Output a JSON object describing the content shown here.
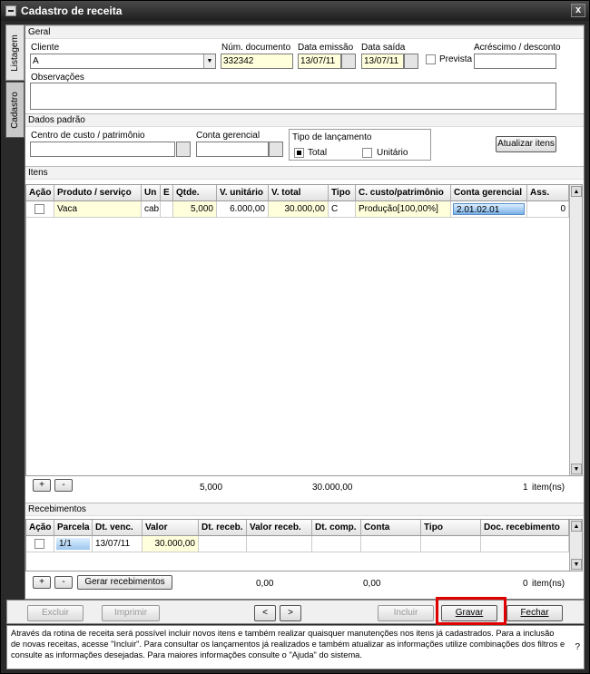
{
  "window": {
    "title": "Cadastro de receita",
    "close_glyph": "x"
  },
  "tabs": [
    {
      "label": "Listagem"
    },
    {
      "label": "Cadastro"
    }
  ],
  "geral": {
    "section_title": "Geral",
    "cliente_label": "Cliente",
    "cliente_value": "A",
    "num_doc_label": "Núm. documento",
    "num_doc_value": "332342",
    "data_emissao_label": "Data emissão",
    "data_emissao_value": "13/07/11",
    "data_saida_label": "Data saída",
    "data_saida_value": "13/07/11",
    "prevista_label": "Prevista",
    "acrescimo_label": "Acréscimo / desconto",
    "acrescimo_value": "",
    "observacoes_label": "Observações",
    "observacoes_value": ""
  },
  "dados_padrao": {
    "section_title": "Dados padrão",
    "centro_label": "Centro de custo / patrimônio",
    "centro_value": "",
    "conta_label": "Conta gerencial",
    "conta_value": "",
    "tipo_label": "Tipo de lançamento",
    "total_label": "Total",
    "unitario_label": "Unitário",
    "atualizar_label": "Atualizar itens"
  },
  "itens": {
    "section_title": "Itens",
    "columns": [
      "Ação",
      "Produto / serviço",
      "Un",
      "E",
      "Qtde.",
      "V. unitário",
      "V. total",
      "Tipo",
      "C. custo/patrimônio",
      "Conta gerencial",
      "Ass."
    ],
    "rows": [
      {
        "produto": "Vaca",
        "un": "cab",
        "e": "",
        "qtde": "5,000",
        "v_unitario": "6.000,00",
        "v_total": "30.000,00",
        "tipo": "C",
        "ccusto": "Produção[100,00%]",
        "conta": "2.01.02.01",
        "ass": "0"
      }
    ],
    "add_label": "+",
    "remove_label": "-",
    "sum_qtde": "5,000",
    "sum_total": "30.000,00",
    "item_count": "1",
    "item_unit": "item(ns)"
  },
  "recebimentos": {
    "section_title": "Recebimentos",
    "columns": [
      "Ação",
      "Parcela",
      "Dt. venc.",
      "Valor",
      "Dt. receb.",
      "Valor receb.",
      "Dt. comp.",
      "Conta",
      "Tipo",
      "Doc. recebimento"
    ],
    "rows": [
      {
        "parcela": "1/1",
        "dt_venc": "13/07/11",
        "valor": "30.000,00",
        "dt_receb": "",
        "valor_receb": "",
        "dt_comp": "",
        "conta": "",
        "tipo": "",
        "doc": ""
      }
    ],
    "add_label": "+",
    "remove_label": "-",
    "gerar_label": "Gerar recebimentos",
    "sum_1": "0,00",
    "sum_2": "0,00",
    "item_count": "0",
    "item_unit": "item(ns)"
  },
  "actions": {
    "excluir": "Excluir",
    "imprimir": "Imprimir",
    "prev": "<",
    "next": ">",
    "incluir": "Incluir",
    "gravar": "Gravar",
    "fechar": "Fechar"
  },
  "help": {
    "text": "Através da rotina de receita será possível incluir novos itens e também realizar quaisquer manutenções nos itens já cadastrados. Para a inclusão de novas receitas, acesse \"Incluir\". Para consultar os lançamentos já realizados e também atualizar as informações utilize combinações dos filtros e consulte as informações desejadas. Para maiores informações consulte o \"Ajuda\" do sistema.",
    "qmark": "?"
  },
  "colors": {
    "highlight": "#e00000",
    "field_yellow": "#ffffdc",
    "selection_blue": "#7ab0e6"
  }
}
